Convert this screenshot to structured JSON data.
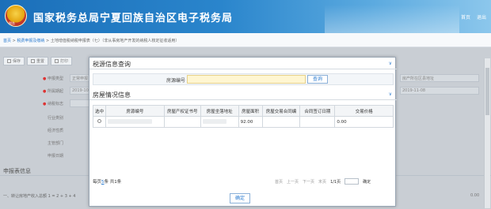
{
  "header": {
    "emblem_text": "税务",
    "title": "国家税务总局宁夏回族自治区电子税务局",
    "links": [
      "首页",
      "退出"
    ]
  },
  "breadcrumb": {
    "home": "首页",
    "sep": ">",
    "level1": "税费申报及缴纳",
    "level2": "土地增值税纳税申报表（七）（非从事房地产开发的纳税人核定征收适用）"
  },
  "background": {
    "toolbar": [
      "保存",
      "重置",
      "打印"
    ],
    "rows": [
      {
        "label": "申报类型",
        "value": "正常申报"
      },
      {
        "label": "所属期起",
        "value": "2019-10-..."
      },
      {
        "label": "纳税标志",
        "value": ""
      },
      {
        "label": "行业类别",
        "value": ""
      },
      {
        "label": "经济性质",
        "value": ""
      },
      {
        "label": "主管部门",
        "value": ""
      },
      {
        "label": "申报日期",
        "value": ""
      }
    ],
    "right_values": [
      "房产所在区县地址",
      "2019-11-08"
    ],
    "section": "申报表信息",
    "bottom_text": "一、转让房地产收入总额 1 = 2 + 3 + 4",
    "bottom_value": "0.00"
  },
  "modal": {
    "section1_title": "税源信息查询",
    "query_label": "房源编号",
    "query_value": "",
    "query_button": "查询",
    "section2_title": "房屋情况信息",
    "columns": [
      "选中",
      "房源编号",
      "房屋产权证书号",
      "房屋坐落地址",
      "房屋面积",
      "房屋交易合同编",
      "合同签订日期",
      "交易价格"
    ],
    "rows": [
      {
        "area": "92.00",
        "price": "0.00"
      }
    ],
    "pager": {
      "per_page_prefix": "每页",
      "per_page": "5",
      "per_page_suffix": "条 共1条",
      "first": "首页",
      "prev": "上一页",
      "next": "下一页",
      "last": "末页",
      "page_info": "1/1页",
      "go": "确定"
    },
    "ok_button": "确定"
  }
}
